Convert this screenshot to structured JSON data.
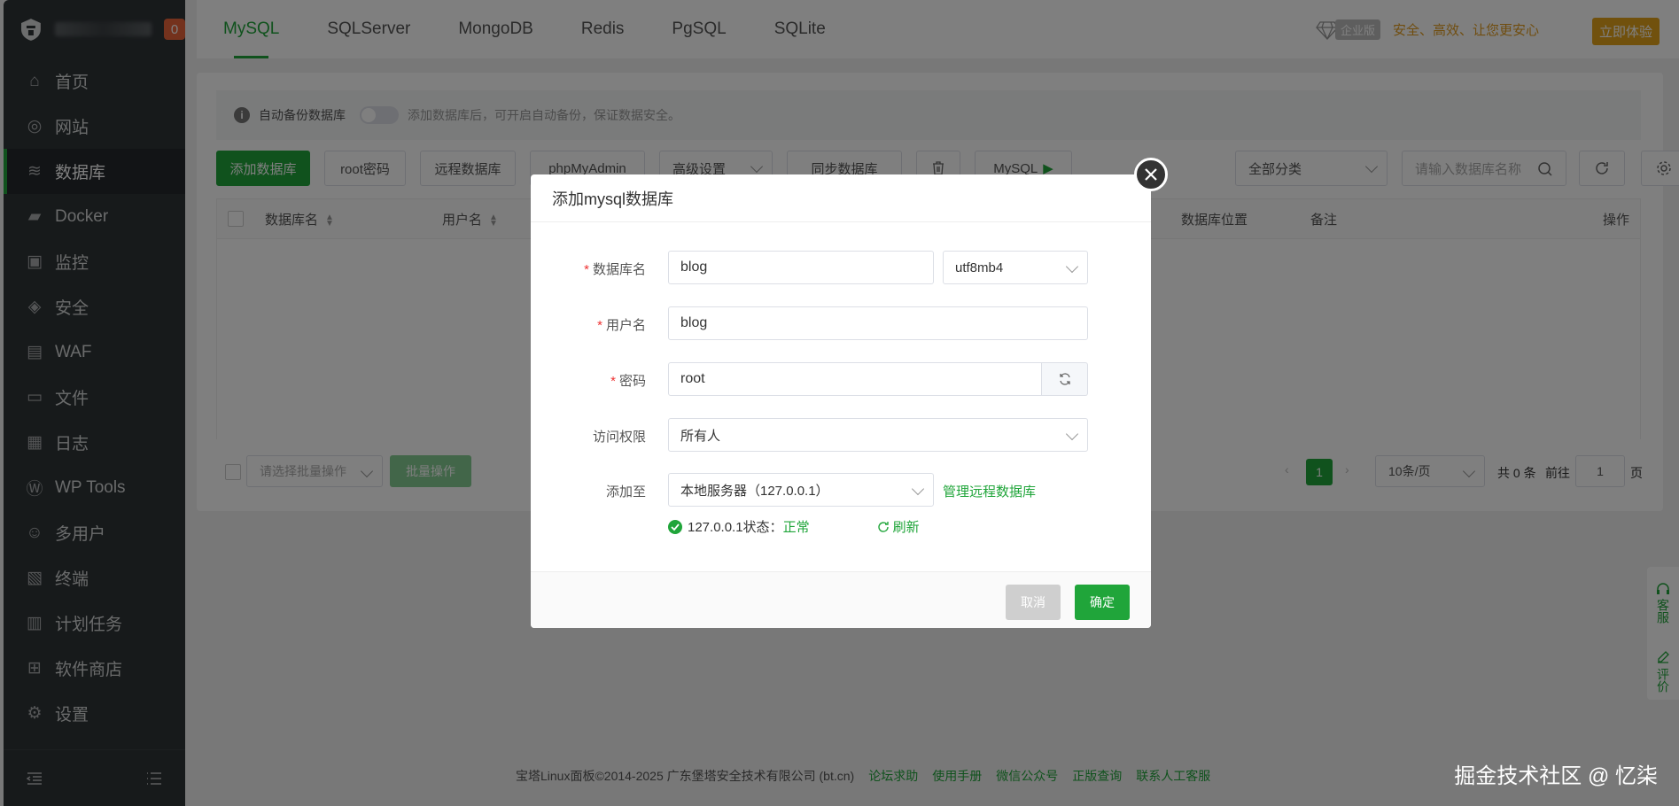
{
  "sidebar": {
    "badge": "0",
    "items": [
      {
        "label": "首页",
        "icon": "home-icon"
      },
      {
        "label": "网站",
        "icon": "globe-icon"
      },
      {
        "label": "数据库",
        "icon": "database-icon"
      },
      {
        "label": "Docker",
        "icon": "docker-icon"
      },
      {
        "label": "监控",
        "icon": "monitor-icon"
      },
      {
        "label": "安全",
        "icon": "shield-icon"
      },
      {
        "label": "WAF",
        "icon": "waf-icon"
      },
      {
        "label": "文件",
        "icon": "folder-icon"
      },
      {
        "label": "日志",
        "icon": "log-icon"
      },
      {
        "label": "WP Tools",
        "icon": "wordpress-icon"
      },
      {
        "label": "多用户",
        "icon": "users-icon"
      },
      {
        "label": "终端",
        "icon": "terminal-icon"
      },
      {
        "label": "计划任务",
        "icon": "calendar-icon"
      },
      {
        "label": "软件商店",
        "icon": "grid-icon"
      },
      {
        "label": "设置",
        "icon": "gear-icon"
      }
    ],
    "active_index": 2
  },
  "tabs": [
    "MySQL",
    "SQLServer",
    "MongoDB",
    "Redis",
    "PgSQL",
    "SQLite"
  ],
  "header": {
    "enterprise_tag": "企业版",
    "slogan": "安全、高效、让您更安心",
    "try_button": "立即体验"
  },
  "notice": {
    "label": "自动备份数据库",
    "hint": "添加数据库后，可开启自动备份，保证数据安全。"
  },
  "toolbar": {
    "add_db": "添加数据库",
    "root_pwd": "root密码",
    "remote_db": "远程数据库",
    "phpmyadmin": "phpMyAdmin",
    "advanced": "高级设置",
    "sync_db": "同步数据库",
    "mysql": "MySQL",
    "category": "全部分类",
    "search_placeholder": "请输入数据库名称"
  },
  "table": {
    "headers": [
      "数据库名",
      "用户名",
      "数据库位置",
      "备注",
      "操作"
    ]
  },
  "footer_bar": {
    "batch_placeholder": "请选择批量操作",
    "batch_btn": "批量操作",
    "current_page": "1",
    "page_size": "10条/页",
    "total": "共 0 条",
    "goto": "前往",
    "goto_value": "1",
    "page_unit": "页"
  },
  "modal": {
    "title": "添加mysql数据库",
    "db_name_label": "数据库名",
    "db_name_value": "blog",
    "charset": "utf8mb4",
    "user_label": "用户名",
    "user_value": "blog",
    "password_label": "密码",
    "password_value": "root",
    "access_label": "访问权限",
    "access_value": "所有人",
    "add_to_label": "添加至",
    "add_to_value": "本地服务器（127.0.0.1）",
    "manage_remote": "管理远程数据库",
    "status_prefix": "127.0.0.1状态：",
    "status_value": "正常",
    "refresh": "刷新",
    "cancel": "取消",
    "confirm": "确定"
  },
  "float_right": {
    "service": "客服",
    "review": "评价"
  },
  "page_footer": {
    "copyright": "宝塔Linux面板©2014-2025 广东堡塔安全技术有限公司 (bt.cn)",
    "links": [
      "论坛求助",
      "使用手册",
      "微信公众号",
      "正版查询",
      "联系人工客服"
    ]
  },
  "watermark": "掘金技术社区 @ 忆柒",
  "colors": {
    "accent": "#20a53a",
    "sidebar": "#2f3437",
    "gold": "#e3a21a"
  }
}
